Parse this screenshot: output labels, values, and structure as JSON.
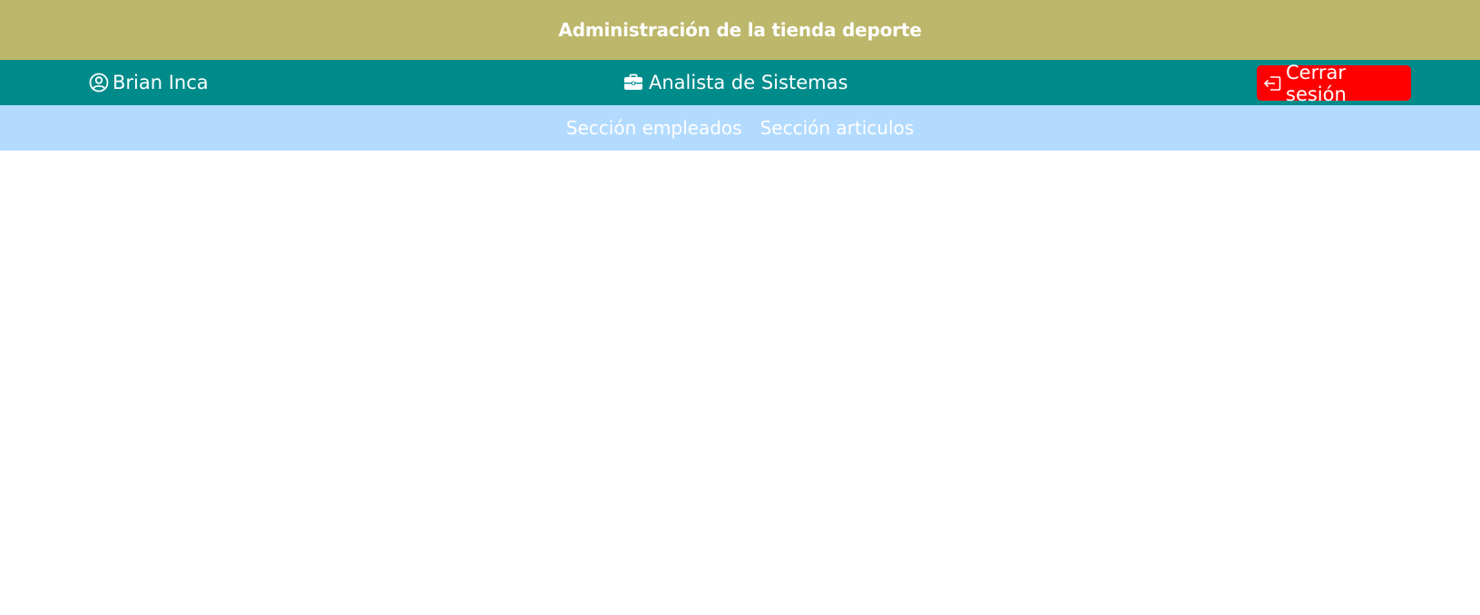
{
  "header": {
    "title": "Administración de la tienda deporte"
  },
  "user_bar": {
    "user_name": "Brian Inca",
    "user_icon": "user-circle-icon",
    "role": "Analista de Sistemas",
    "role_icon": "briefcase-icon",
    "logout_label": "Cerrar sesión",
    "logout_icon": "logout-icon"
  },
  "nav": {
    "items": [
      {
        "label": "Sección empleados"
      },
      {
        "label": "Sección articulos"
      }
    ]
  },
  "colors": {
    "title_bar": "#bdb76b",
    "user_bar": "#008b8b",
    "nav_bar": "#b3dbff",
    "logout_button": "#ff0000",
    "text": "#ffffff"
  }
}
